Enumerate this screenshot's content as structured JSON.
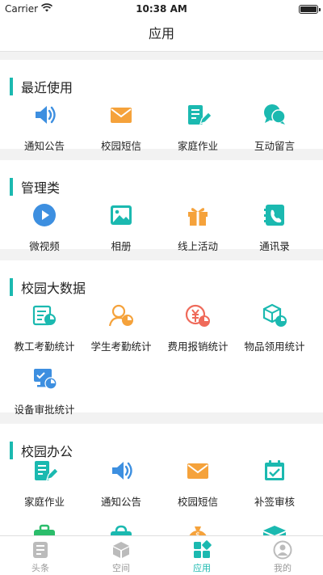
{
  "status_bar": {
    "carrier": "Carrier",
    "time": "10:38 AM"
  },
  "nav": {
    "title": "应用"
  },
  "colors": {
    "accent": "#1bb9b0",
    "blue": "#3d8fe0",
    "orange": "#f5a23b",
    "red": "#ef6a5a",
    "teal": "#1bb9b0",
    "green": "#2bbd6b"
  },
  "sections": [
    {
      "title": "最近使用",
      "items": [
        {
          "label": "通知公告",
          "icon": "speaker-icon"
        },
        {
          "label": "校园短信",
          "icon": "envelope-icon"
        },
        {
          "label": "家庭作业",
          "icon": "homework-icon"
        },
        {
          "label": "互动留言",
          "icon": "chat-bubbles-icon"
        }
      ]
    },
    {
      "title": "管理类",
      "items": [
        {
          "label": "微视频",
          "icon": "play-icon"
        },
        {
          "label": "相册",
          "icon": "photo-icon"
        },
        {
          "label": "线上活动",
          "icon": "gift-icon"
        },
        {
          "label": "通讯录",
          "icon": "contacts-icon"
        }
      ]
    },
    {
      "title": "校园大数据",
      "items": [
        {
          "label": "教工考勤统计",
          "icon": "staff-attendance-icon"
        },
        {
          "label": "学生考勤统计",
          "icon": "student-attendance-icon"
        },
        {
          "label": "费用报销统计",
          "icon": "expense-stats-icon"
        },
        {
          "label": "物品领用统计",
          "icon": "goods-stats-icon"
        },
        {
          "label": "设备审批统计",
          "icon": "device-approval-icon"
        }
      ]
    },
    {
      "title": "校园办公",
      "items": [
        {
          "label": "家庭作业",
          "icon": "homework-icon"
        },
        {
          "label": "通知公告",
          "icon": "speaker-icon"
        },
        {
          "label": "校园短信",
          "icon": "envelope-icon"
        },
        {
          "label": "补签审核",
          "icon": "calendar-check-icon"
        }
      ]
    }
  ],
  "tabs": [
    {
      "label": "头条",
      "icon": "headline-icon",
      "active": false
    },
    {
      "label": "空间",
      "icon": "cube-icon",
      "active": false
    },
    {
      "label": "应用",
      "icon": "apps-grid-icon",
      "active": true
    },
    {
      "label": "我的",
      "icon": "profile-icon",
      "active": false
    }
  ]
}
